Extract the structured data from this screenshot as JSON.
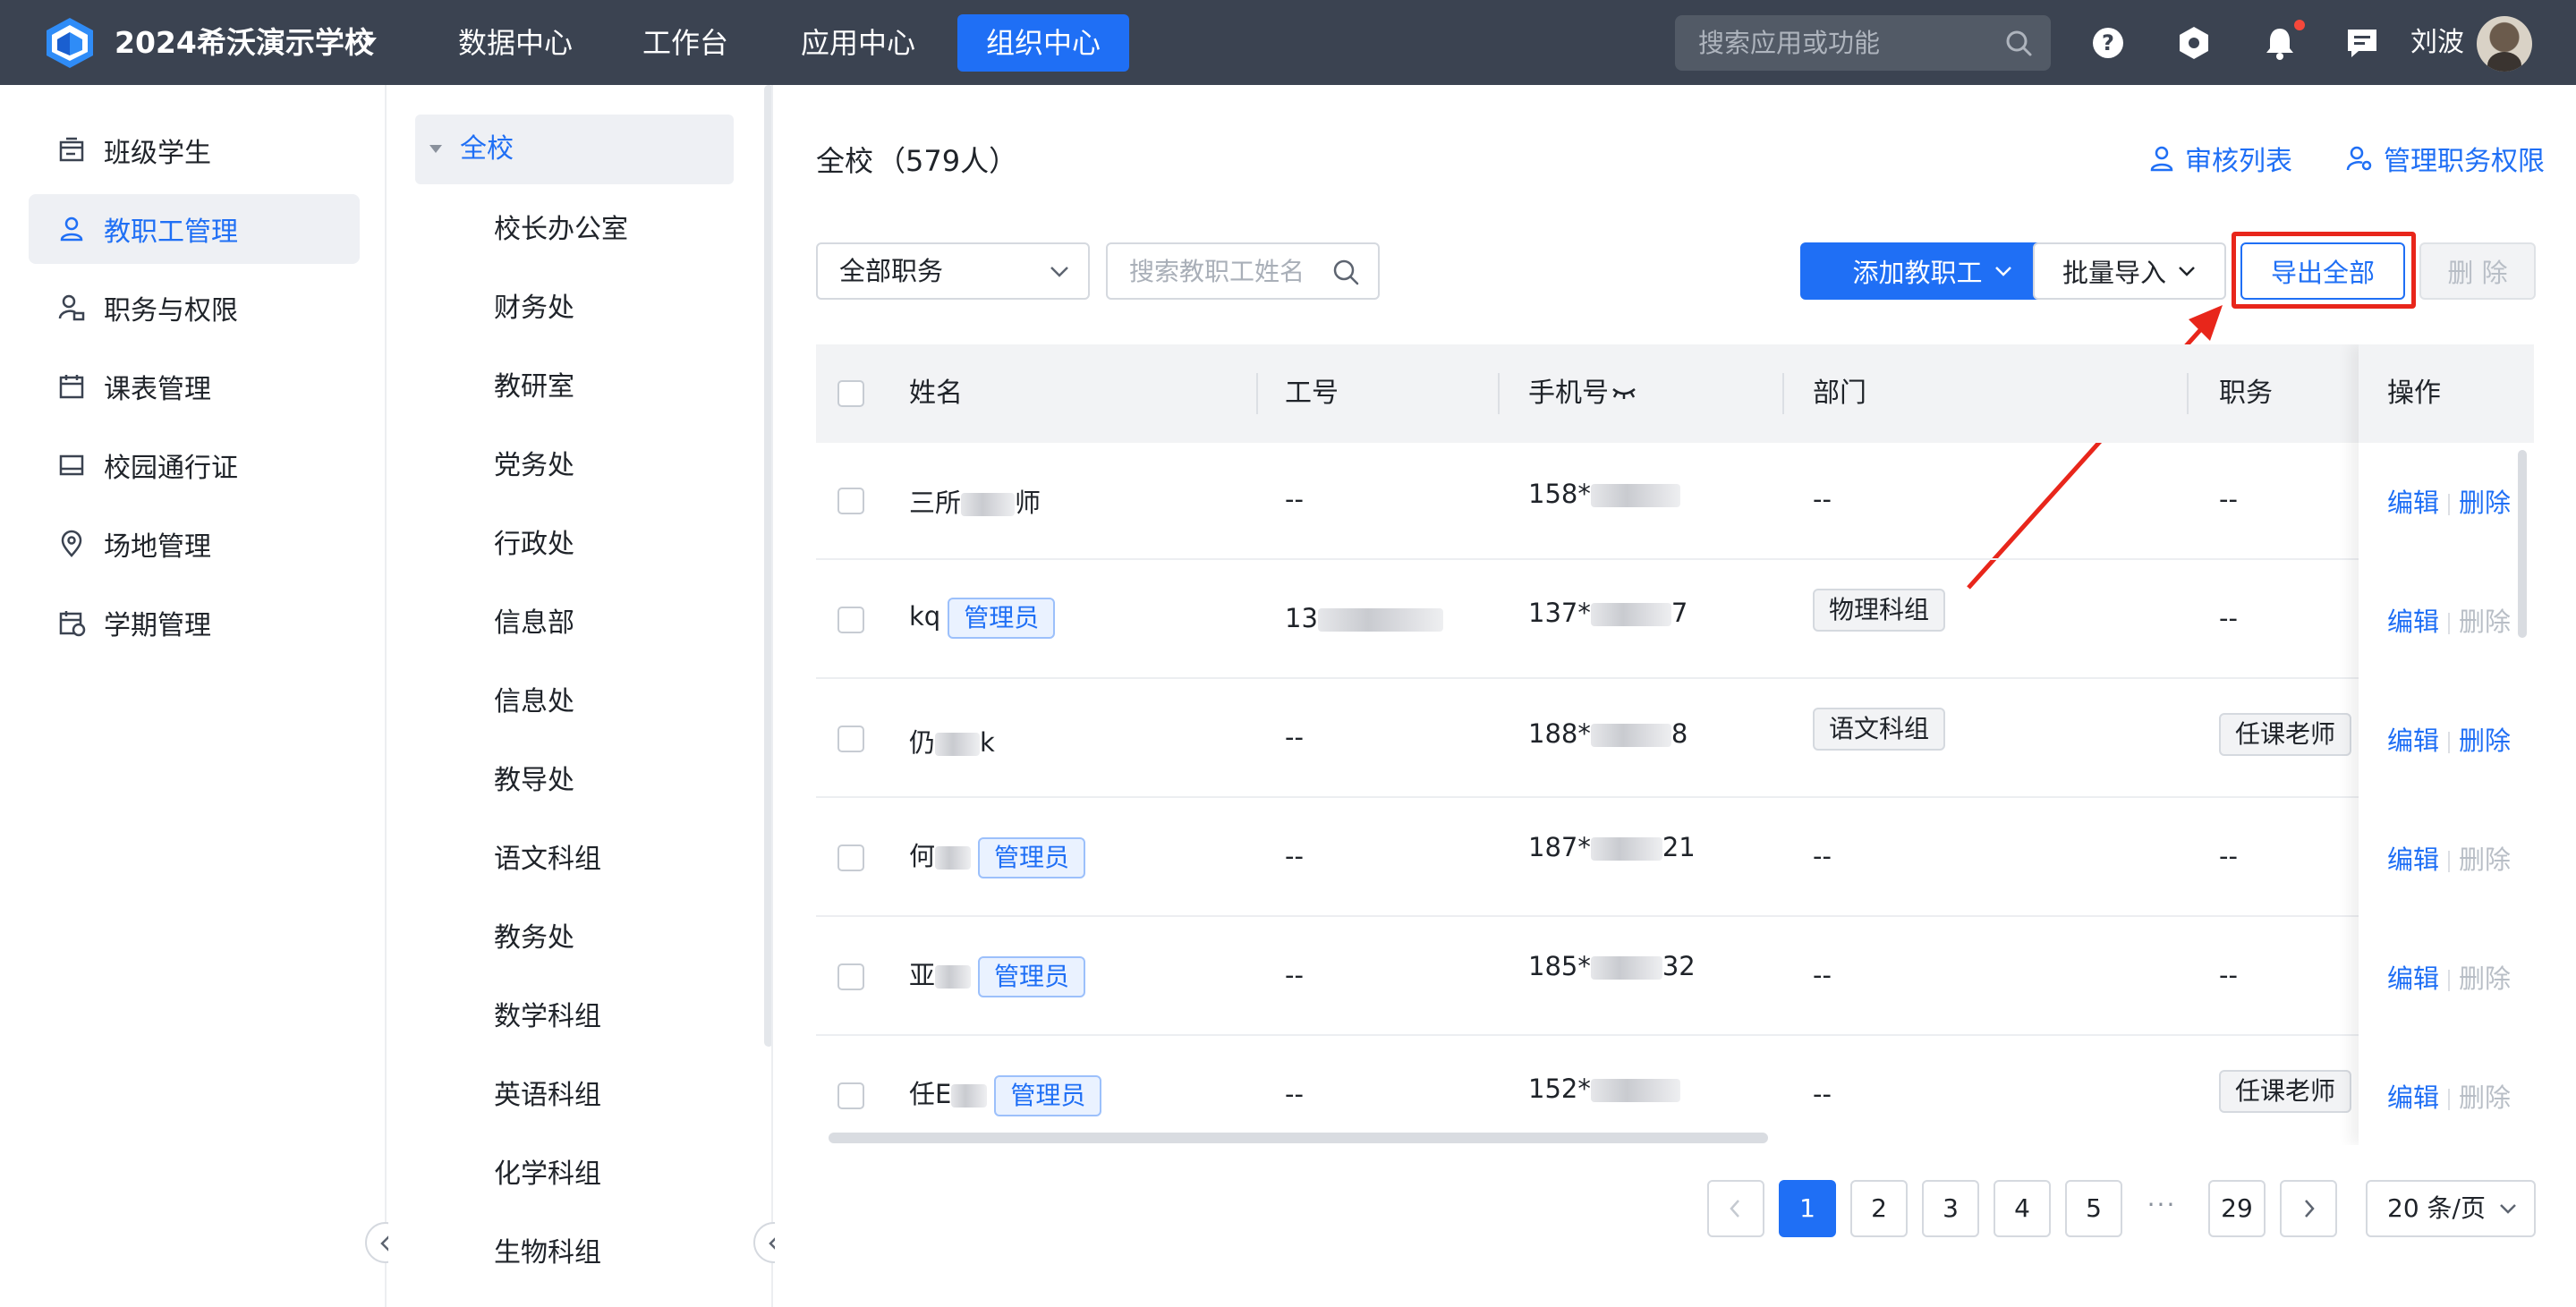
{
  "topbar": {
    "school_name": "2024希沃演示学校",
    "nav": [
      "数据中心",
      "工作台",
      "应用中心",
      "组织中心"
    ],
    "active_nav": "组织中心",
    "search_placeholder": "搜索应用或功能",
    "user_name": "刘波",
    "icons": [
      "help-icon",
      "settings-hex-icon",
      "bell-icon",
      "message-icon"
    ],
    "accent_color": "#1f6ff5",
    "bar_color": "#3b4351"
  },
  "sidebar": {
    "items": [
      {
        "label": "班级学生",
        "icon": "class-icon"
      },
      {
        "label": "教职工管理",
        "icon": "user-icon",
        "active": true
      },
      {
        "label": "职务与权限",
        "icon": "user-lock-icon"
      },
      {
        "label": "课表管理",
        "icon": "calendar-icon"
      },
      {
        "label": "校园通行证",
        "icon": "card-icon"
      },
      {
        "label": "场地管理",
        "icon": "location-icon"
      },
      {
        "label": "学期管理",
        "icon": "term-calendar-icon"
      }
    ]
  },
  "tree": {
    "root": "全校",
    "nodes": [
      "校长办公室",
      "财务处",
      "教研室",
      "党务处",
      "行政处",
      "信息部",
      "信息处",
      "教导处",
      "语文科组",
      "教务处",
      "数学科组",
      "英语科组",
      "化学科组",
      "生物科组"
    ]
  },
  "main": {
    "title": "全校",
    "title_count": "（579人）",
    "links": {
      "review": "审核列表",
      "manage_roles": "管理职务权限"
    },
    "filter": {
      "role_select": "全部职务",
      "search_placeholder": "搜索教职工姓名"
    },
    "buttons": {
      "add": "添加教职工",
      "import": "批量导入",
      "export": "导出全部",
      "delete": "删 除"
    },
    "table": {
      "headers": {
        "name": "姓名",
        "id": "工号",
        "phone": "手机号",
        "dept": "部门",
        "role": "职务",
        "ops": "操作"
      },
      "rows": [
        {
          "name_a": "三所",
          "name_b": "师",
          "admin": "",
          "id": "--",
          "phone_a": "158*",
          "phone_b": "",
          "dept": "--",
          "role": "--",
          "edit": "编辑",
          "del": "删除",
          "del_enabled": true
        },
        {
          "name_a": "kq",
          "name_b": "",
          "admin": "管理员",
          "id": "13",
          "phone_a": "137*",
          "phone_b": "7",
          "dept": "物理科组",
          "role": "--",
          "edit": "编辑",
          "del": "删除",
          "del_enabled": false
        },
        {
          "name_a": "仍",
          "name_b": "k",
          "admin": "",
          "id": "--",
          "phone_a": "188*",
          "phone_b": "8",
          "dept": "语文科组",
          "role": "任课老师",
          "edit": "编辑",
          "del": "删除",
          "del_enabled": true
        },
        {
          "name_a": "何",
          "name_b": "",
          "admin": "管理员",
          "id": "--",
          "phone_a": "187*",
          "phone_b": "21",
          "dept": "--",
          "role": "--",
          "edit": "编辑",
          "del": "删除",
          "del_enabled": false
        },
        {
          "name_a": "亚",
          "name_b": "",
          "admin": "管理员",
          "id": "--",
          "phone_a": "185*",
          "phone_b": "32",
          "dept": "--",
          "role": "--",
          "edit": "编辑",
          "del": "删除",
          "del_enabled": false
        },
        {
          "name_a": "任E",
          "name_b": "",
          "admin": "管理员",
          "id": "--",
          "phone_a": "152*",
          "phone_b": "",
          "dept": "--",
          "role": "任课老师",
          "edit": "编辑",
          "del": "删除",
          "del_enabled": false
        }
      ]
    },
    "pagination": {
      "pages": [
        "1",
        "2",
        "3",
        "4",
        "5"
      ],
      "ellipsis": "···",
      "last": "29",
      "current": "1",
      "page_size": "20 条/页"
    }
  }
}
